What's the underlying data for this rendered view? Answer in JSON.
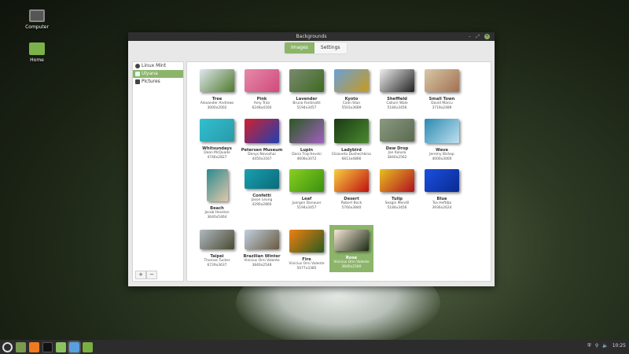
{
  "desktop": {
    "icons": [
      {
        "label": "Computer"
      },
      {
        "label": "Home"
      }
    ]
  },
  "window": {
    "title": "Backgrounds",
    "controls": {
      "minimize": "–",
      "maximize": "⤢",
      "close": "✕"
    }
  },
  "tabs": [
    {
      "label": "Images",
      "active": true
    },
    {
      "label": "Settings",
      "active": false
    }
  ],
  "sidebar": {
    "items": [
      {
        "label": "Linux Mint",
        "icon": "linux-mint-icon"
      },
      {
        "label": "Ulyana",
        "icon": "monitor-icon",
        "selected": true
      },
      {
        "label": "Pictures",
        "icon": "camera-icon"
      }
    ],
    "add": "+",
    "remove": "−"
  },
  "accent": "#8cb56a",
  "backgrounds": [
    {
      "name": "Tree",
      "author": "Alexander Andrews",
      "size": "3000x2002",
      "colors": [
        "#dfe6ee",
        "#4e7a2c"
      ]
    },
    {
      "name": "Pink",
      "author": "Amy Tran",
      "size": "6248x4160",
      "colors": [
        "#e58aa8",
        "#d04a7c"
      ]
    },
    {
      "name": "Lavender",
      "author": "Bruno Fantinatti",
      "size": "5194x3457",
      "colors": [
        "#7a8a70",
        "#3e6a20"
      ]
    },
    {
      "name": "Kyoto",
      "author": "Calin Stan",
      "size": "5503x3689",
      "colors": [
        "#6aa0d8",
        "#c89a20"
      ]
    },
    {
      "name": "Sheffield",
      "author": "Callum Wale",
      "size": "5184x3456",
      "colors": [
        "#eeeeee",
        "#222222"
      ]
    },
    {
      "name": "Small Town",
      "author": "David Marcu",
      "size": "3719x2489",
      "colors": [
        "#d8c8a8",
        "#a07050"
      ]
    },
    {
      "name": "Whitsundays",
      "author": "Dean McQuade",
      "size": "4746x2827",
      "colors": [
        "#30c0d0",
        "#2a9aa8"
      ]
    },
    {
      "name": "Petersen Museum",
      "author": "Denys Nevozhai",
      "size": "4450x3167",
      "colors": [
        "#d02030",
        "#2040b0"
      ]
    },
    {
      "name": "Lupin",
      "author": "Dario Trajchevski",
      "size": "4608x3072",
      "colors": [
        "#2a5a20",
        "#a060c0"
      ]
    },
    {
      "name": "Ladybird",
      "author": "Elizaveta Dushechkina",
      "size": "6813x4866",
      "colors": [
        "#1a3a14",
        "#4a8a30"
      ]
    },
    {
      "name": "Dew Drop",
      "author": "Jan Kaluza",
      "size": "3840x2562",
      "colors": [
        "#8a9a80",
        "#5a6a50"
      ]
    },
    {
      "name": "Wave",
      "author": "Jeremy Bishop",
      "size": "4000x3000",
      "colors": [
        "#2a8ab0",
        "#c0e0f0"
      ]
    },
    {
      "name": "Beach",
      "author": "Jacob Hesston",
      "size": "3640x5464",
      "colors": [
        "#2a8a90",
        "#e0c8a8"
      ]
    },
    {
      "name": "Confetti",
      "author": "Jason Leung",
      "size": "4290x2860",
      "colors": [
        "#1aa0b0",
        "#0a6a78"
      ]
    },
    {
      "name": "Leaf",
      "author": "Juergen Donauer",
      "size": "5194x3457",
      "colors": [
        "#8ad020",
        "#3a9010"
      ]
    },
    {
      "name": "Desert",
      "author": "Robert Bock",
      "size": "5760x3840",
      "colors": [
        "#f8d040",
        "#c01010"
      ]
    },
    {
      "name": "Tulip",
      "author": "Sezgin Mendil",
      "size": "5184x3456",
      "colors": [
        "#e8c020",
        "#b01020"
      ]
    },
    {
      "name": "Blue",
      "author": "Tsa Heftiba",
      "size": "3936x2624",
      "colors": [
        "#1a50e0",
        "#0a2a90"
      ]
    },
    {
      "name": "Taipei",
      "author": "Thomas Tucker",
      "size": "6729x3637",
      "colors": [
        "#b0b8c0",
        "#4a4a30"
      ]
    },
    {
      "name": "Brazilian Winter",
      "author": "Vinicius Orni Valente",
      "size": "3840x2548",
      "colors": [
        "#c0d0e0",
        "#6a5a40"
      ]
    },
    {
      "name": "Fire",
      "author": "Vinicius Orni Valente",
      "size": "5077x3385",
      "colors": [
        "#f08010",
        "#2a5a20"
      ]
    },
    {
      "name": "Rose",
      "author": "Vinicius Orni Valente",
      "size": "3840x2560",
      "colors": [
        "#f8e8d8",
        "#1a2a14"
      ],
      "selected": true
    }
  ],
  "tray": {
    "time": "10:25"
  }
}
